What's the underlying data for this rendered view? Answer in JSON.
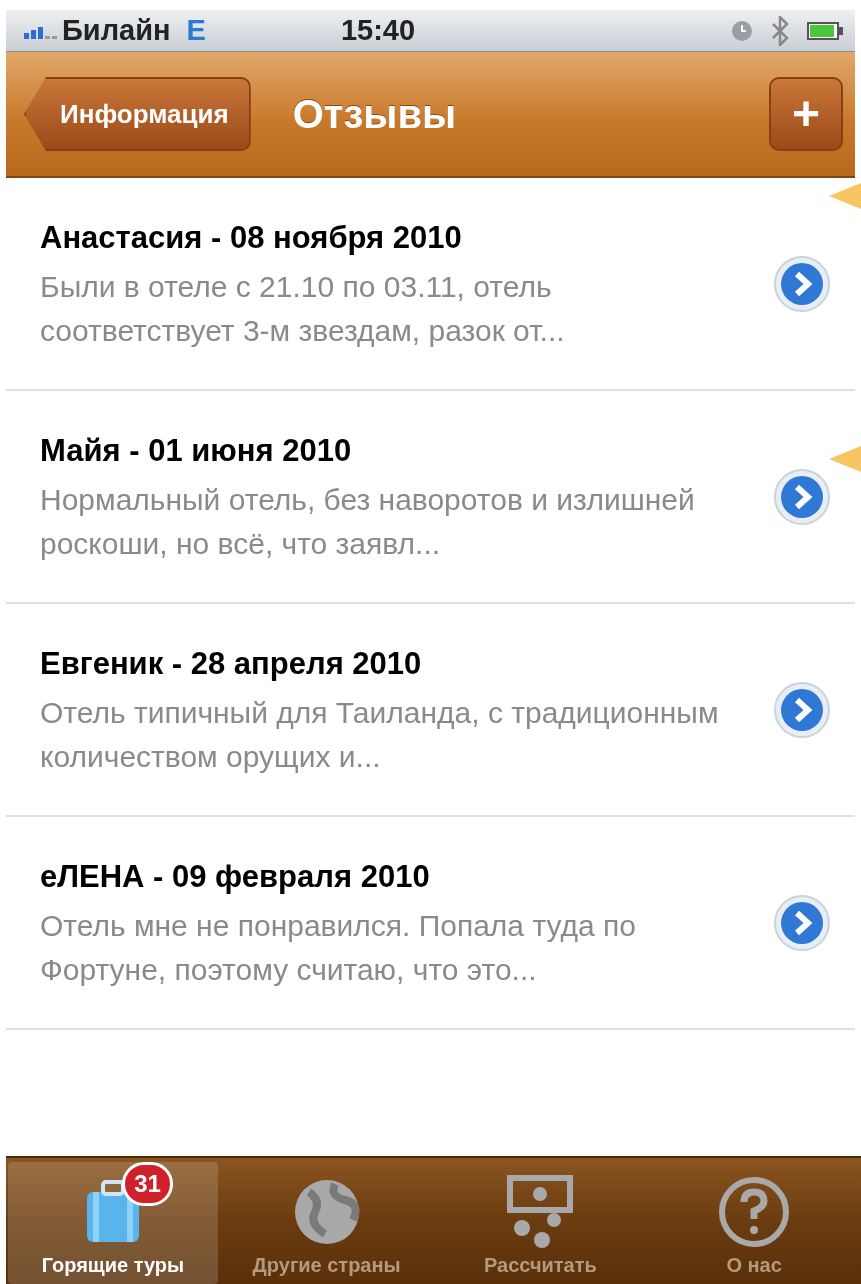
{
  "status_bar": {
    "carrier": "Билайн",
    "network": "E",
    "time": "15:40"
  },
  "nav_bar": {
    "back_button": "Информация",
    "title": "Отзывы",
    "add_button": "+"
  },
  "reviews": [
    {
      "title": "Анастасия - 08 ноября 2010",
      "snippet": "Были в отеле с 21.10 по 03.11, отель соответствует 3-м звездам, разок от...",
      "pointer": true
    },
    {
      "title": "Майя - 01 июня 2010",
      "snippet": "Нормальный отель, без наворотов и излишней роскоши, но всё, что заявл...",
      "pointer": true
    },
    {
      "title": "Евгеник - 28 апреля 2010",
      "snippet": "Отель типичный для Таиланда, с традиционным количеством орущих и...",
      "pointer": false
    },
    {
      "title": "еЛЕНА - 09 февраля 2010",
      "snippet": "Отель мне не понравился. Попала туда по Фортуне, поэтому считаю, что это...",
      "pointer": false
    }
  ],
  "tab_bar": [
    {
      "label": "Горящие туры",
      "kind": "suitcase",
      "badge": "31",
      "selected": true
    },
    {
      "label": "Другие страны",
      "kind": "globe",
      "selected": false
    },
    {
      "label": "Рассчитать",
      "kind": "calculator",
      "selected": false
    },
    {
      "label": "О нас",
      "kind": "help",
      "selected": false
    }
  ]
}
